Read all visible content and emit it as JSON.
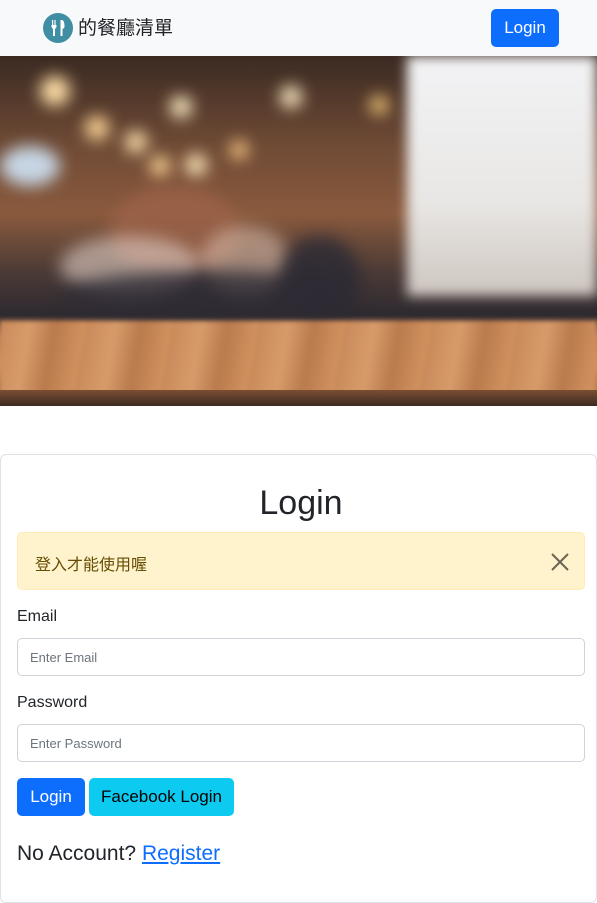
{
  "navbar": {
    "brand_icon": "fork-knife-icon",
    "brand_text": "的餐廳清單",
    "login_label": "Login",
    "accent_color": "#0d6efd"
  },
  "hero": {
    "image_description_icon": "restaurant-hero-image"
  },
  "login_card": {
    "title": "Login",
    "alert": {
      "message": "登入才能使用喔",
      "close_icon": "close-icon",
      "color": "#fff3cd"
    },
    "email": {
      "label": "Email",
      "placeholder": "Enter Email",
      "value": ""
    },
    "password": {
      "label": "Password",
      "placeholder": "Enter Password",
      "value": ""
    },
    "login_button": "Login",
    "facebook_button": "Facebook Login",
    "facebook_color": "#0dcaf0",
    "no_account_text": "No Account?",
    "register_link": "Register"
  }
}
